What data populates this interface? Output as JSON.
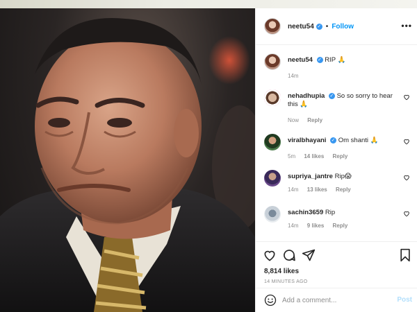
{
  "post": {
    "username": "neetu54",
    "follow_label": "Follow",
    "separator": "•",
    "more_label": "•••"
  },
  "caption": {
    "username": "neetu54",
    "text": "RIP 🙏",
    "time": "14m"
  },
  "comments": [
    {
      "username": "nehadhupia",
      "text": "So so sorry to hear this 🙏",
      "time": "Now",
      "likes": "",
      "reply": "Reply"
    },
    {
      "username": "viralbhayani",
      "text": "Om shanti 🙏",
      "time": "5m",
      "likes": "14 likes",
      "reply": "Reply"
    },
    {
      "username": "supriya_jantre",
      "text": "Rip😱",
      "time": "14m",
      "likes": "13 likes",
      "reply": "Reply"
    },
    {
      "username": "sachin3659",
      "text": "Rip",
      "time": "14m",
      "likes": "9 likes",
      "reply": "Reply"
    }
  ],
  "stats": {
    "likes": "8,814 likes",
    "posted": "14 MINUTES AGO"
  },
  "add_comment": {
    "placeholder": "Add a comment...",
    "post_label": "Post"
  },
  "colors": {
    "accent": "#0095f6",
    "verified": "#3897f0",
    "muted": "#8e8e8e",
    "post_disabled": "#b2dffc"
  }
}
